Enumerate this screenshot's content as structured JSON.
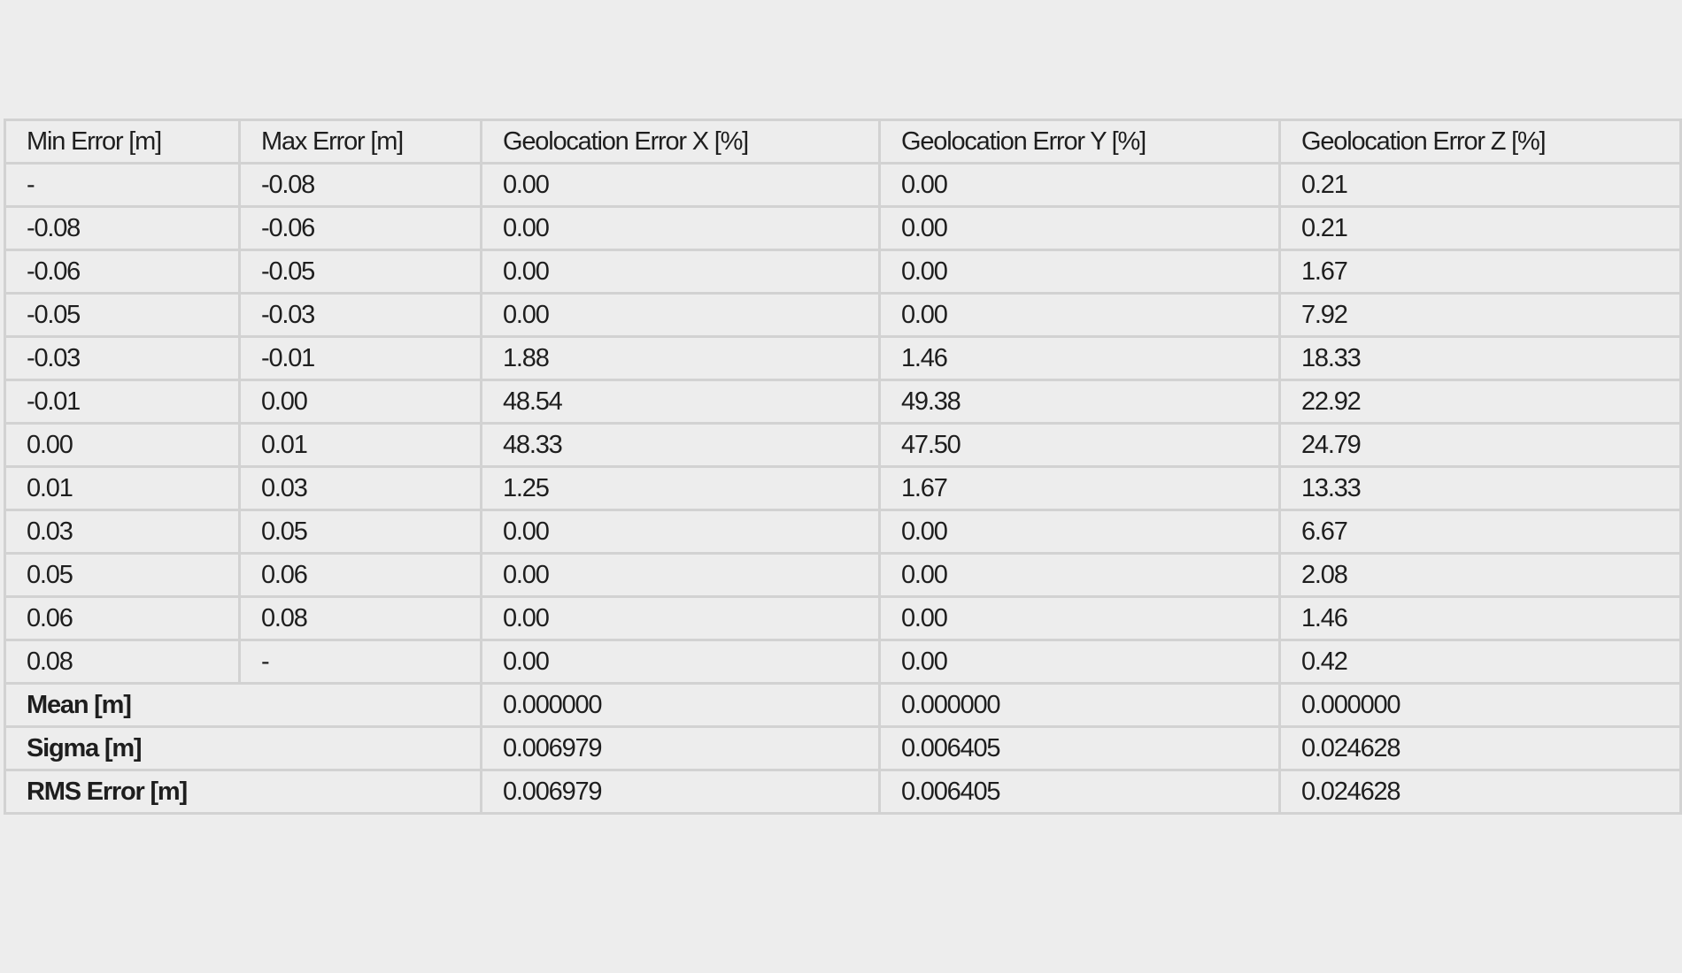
{
  "table": {
    "headers": [
      "Min Error [m]",
      "Max Error [m]",
      "Geolocation Error X [%]",
      "Geolocation Error Y [%]",
      "Geolocation Error Z [%]"
    ],
    "rows": [
      [
        "-",
        "-0.08",
        "0.00",
        "0.00",
        "0.21"
      ],
      [
        "-0.08",
        "-0.06",
        "0.00",
        "0.00",
        "0.21"
      ],
      [
        "-0.06",
        "-0.05",
        "0.00",
        "0.00",
        "1.67"
      ],
      [
        "-0.05",
        "-0.03",
        "0.00",
        "0.00",
        "7.92"
      ],
      [
        "-0.03",
        "-0.01",
        "1.88",
        "1.46",
        "18.33"
      ],
      [
        "-0.01",
        "0.00",
        "48.54",
        "49.38",
        "22.92"
      ],
      [
        "0.00",
        "0.01",
        "48.33",
        "47.50",
        "24.79"
      ],
      [
        "0.01",
        "0.03",
        "1.25",
        "1.67",
        "13.33"
      ],
      [
        "0.03",
        "0.05",
        "0.00",
        "0.00",
        "6.67"
      ],
      [
        "0.05",
        "0.06",
        "0.00",
        "0.00",
        "2.08"
      ],
      [
        "0.06",
        "0.08",
        "0.00",
        "0.00",
        "1.46"
      ],
      [
        "0.08",
        "-",
        "0.00",
        "0.00",
        "0.42"
      ]
    ],
    "summary": [
      {
        "label": "Mean [m]",
        "x": "0.000000",
        "y": "0.000000",
        "z": "0.000000"
      },
      {
        "label": "Sigma [m]",
        "x": "0.006979",
        "y": "0.006405",
        "z": "0.024628"
      },
      {
        "label": "RMS Error [m]",
        "x": "0.006979",
        "y": "0.006405",
        "z": "0.024628"
      }
    ]
  },
  "colors": {
    "background": "#ededed",
    "grid": "#d2d2d2",
    "text": "#1e1e1e"
  }
}
